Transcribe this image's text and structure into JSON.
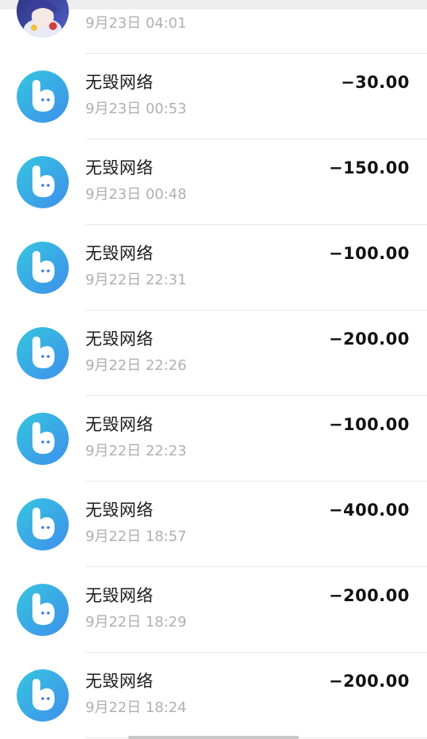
{
  "transactions": [
    {
      "avatar": "game-character-avatar",
      "name": "",
      "time": "9月23日 04:01",
      "amount": ""
    },
    {
      "avatar": "wuhui-network-logo",
      "name": "无毁网络",
      "time": "9月23日 00:53",
      "amount": "−30.00"
    },
    {
      "avatar": "wuhui-network-logo",
      "name": "无毁网络",
      "time": "9月23日 00:48",
      "amount": "−150.00"
    },
    {
      "avatar": "wuhui-network-logo",
      "name": "无毁网络",
      "time": "9月22日 22:31",
      "amount": "−100.00"
    },
    {
      "avatar": "wuhui-network-logo",
      "name": "无毁网络",
      "time": "9月22日 22:26",
      "amount": "−200.00"
    },
    {
      "avatar": "wuhui-network-logo",
      "name": "无毁网络",
      "time": "9月22日 22:23",
      "amount": "−100.00"
    },
    {
      "avatar": "wuhui-network-logo",
      "name": "无毁网络",
      "time": "9月22日 18:57",
      "amount": "−400.00"
    },
    {
      "avatar": "wuhui-network-logo",
      "name": "无毁网络",
      "time": "9月22日 18:29",
      "amount": "−200.00"
    },
    {
      "avatar": "wuhui-network-logo",
      "name": "无毁网络",
      "time": "9月22日 18:24",
      "amount": "−200.00"
    }
  ],
  "colors": {
    "logo_gradient_start": "#35c6df",
    "logo_gradient_end": "#3e8fec",
    "text_primary": "#1a1a1a",
    "text_secondary": "#b0b0b0"
  }
}
